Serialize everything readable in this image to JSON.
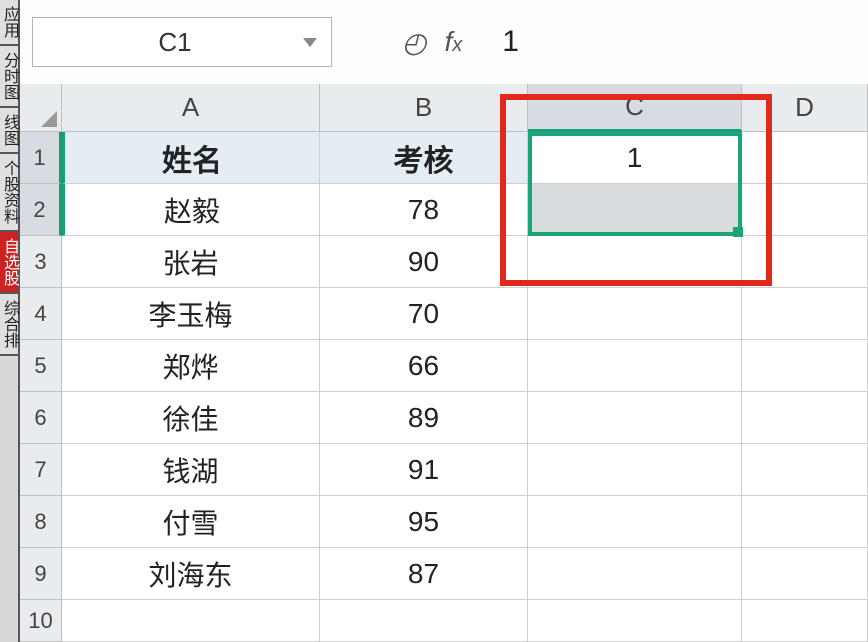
{
  "name_box": "C1",
  "formula_value": "1",
  "ribbon": {
    "items": [
      "应用",
      "分时图",
      "线图",
      "个股资料",
      "自选股",
      "综合排"
    ],
    "red_index": 4
  },
  "columns": [
    "A",
    "B",
    "C",
    "D"
  ],
  "row_numbers": [
    "1",
    "2",
    "3",
    "4",
    "5",
    "6",
    "7",
    "8",
    "9",
    "10"
  ],
  "headers": {
    "A": "姓名",
    "B": "考核"
  },
  "rows": [
    {
      "name": "赵毅",
      "score": "78"
    },
    {
      "name": "张岩",
      "score": "90"
    },
    {
      "name": "李玉梅",
      "score": "70"
    },
    {
      "name": "郑烨",
      "score": "66"
    },
    {
      "name": "徐佳",
      "score": "89"
    },
    {
      "name": "钱湖",
      "score": "91"
    },
    {
      "name": "付雪",
      "score": "95"
    },
    {
      "name": "刘海东",
      "score": "87"
    }
  ],
  "c1_value": "1",
  "selection_range": "C1:C2",
  "colors": {
    "selection": "#1aa679",
    "annotation": "#e0281b",
    "header_fill": "#e4edf4"
  }
}
